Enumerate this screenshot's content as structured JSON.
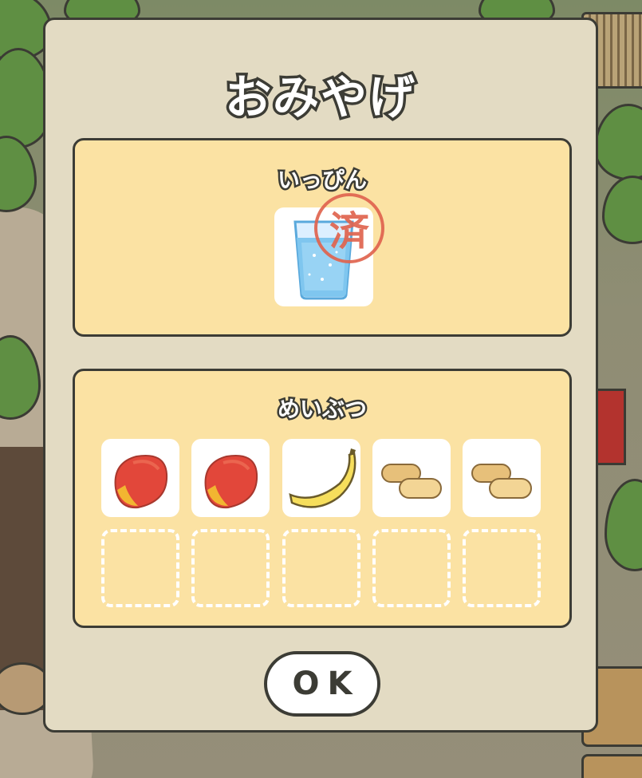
{
  "dialog": {
    "title": "おみやげ",
    "ok_label": "OK"
  },
  "special": {
    "label": "いっぴん",
    "item": {
      "icon": "glass-of-water-icon",
      "stamp": "済"
    }
  },
  "local": {
    "label": "めいぶつ",
    "items": [
      {
        "icon": "mango-icon"
      },
      {
        "icon": "mango-icon"
      },
      {
        "icon": "banana-icon"
      },
      {
        "icon": "cookie-icon"
      },
      {
        "icon": "cookie-icon"
      }
    ],
    "empty_slots": 5
  },
  "colors": {
    "dialog_bg": "#e3dbc3",
    "panel_bg": "#fbe2a3",
    "outline": "#3c3c35",
    "stamp": "#e0644f"
  }
}
